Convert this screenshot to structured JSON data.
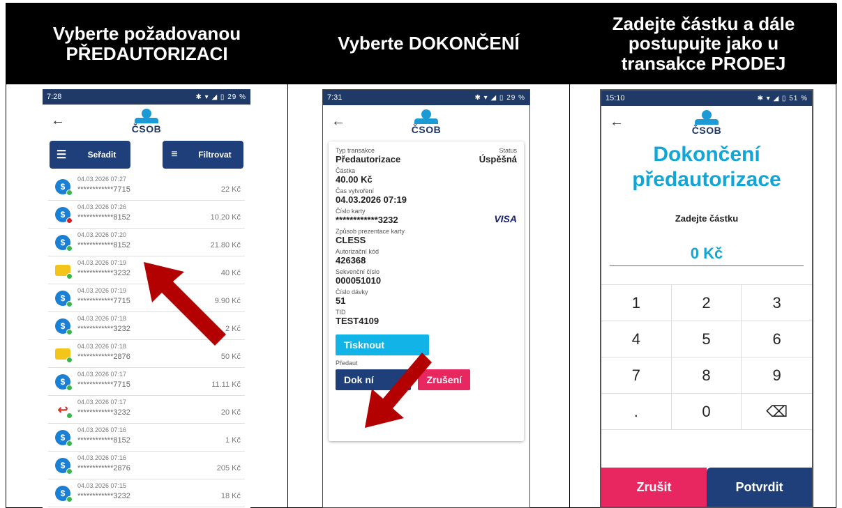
{
  "headers": [
    {
      "text": "Vyberte požadovanou PŘEDAUTORIZACI"
    },
    {
      "text": "Vyberte DOKONČENÍ"
    },
    {
      "text": "Zadejte částku a dále postupujte jako u transakce PRODEJ"
    }
  ],
  "phone1": {
    "time": "7:28",
    "status_icons": "✱ ▾ ◢ ▯ 29 %",
    "logo": "ČSOB",
    "sort_label": "Seřadit",
    "filter_label": "Filtrovat",
    "transactions": [
      {
        "date": "04.03.2026 07:27",
        "pan": "************7715",
        "amount": "22 Kč"
      },
      {
        "date": "04.03.2026 07:26",
        "pan": "************8152",
        "amount": "10.20 Kč"
      },
      {
        "date": "04.03.2026 07:20",
        "pan": "************8152",
        "amount": "21.80 Kč"
      },
      {
        "date": "04.03.2026 07:19",
        "pan": "************3232",
        "amount": "40 Kč"
      },
      {
        "date": "04.03.2026 07:19",
        "pan": "************7715",
        "amount": "9.90 Kč"
      },
      {
        "date": "04.03.2026 07:18",
        "pan": "************3232",
        "amount": "2 Kč"
      },
      {
        "date": "04.03.2026 07:18",
        "pan": "************2876",
        "amount": "50 Kč"
      },
      {
        "date": "04.03.2026 07:17",
        "pan": "************7715",
        "amount": "11.11 Kč"
      },
      {
        "date": "04.03.2026 07:17",
        "pan": "************3232",
        "amount": "20 Kč"
      },
      {
        "date": "04.03.2026 07:16",
        "pan": "************8152",
        "amount": "1 Kč"
      },
      {
        "date": "04.03.2026 07:16",
        "pan": "************2876",
        "amount": "205 Kč"
      },
      {
        "date": "04.03.2026 07:15",
        "pan": "************3232",
        "amount": "18 Kč"
      }
    ]
  },
  "phone2": {
    "time": "7:31",
    "status_icons": "✱ ▾ ◢ ▯ 29 %",
    "logo": "ČSOB",
    "type_label": "Typ transakce",
    "type_value": "Předautorizace",
    "status_label": "Status",
    "status_value": "Úspěšná",
    "amount_label": "Částka",
    "amount_value": "40.00 Kč",
    "created_label": "Čas vytvoření",
    "created_value": "04.03.2026 07:19",
    "card_label": "Číslo karty",
    "card_value": "************3232",
    "card_brand": "VISA",
    "present_label": "Způsob prezentace karty",
    "present_value": "CLESS",
    "auth_label": "Autorizační kód",
    "auth_value": "426368",
    "seq_label": "Sekvenční číslo",
    "seq_value": "000051010",
    "batch_label": "Číslo dávky",
    "batch_value": "51",
    "tid_label": "TID",
    "tid_value": "TEST4109",
    "print_label": "Tisknout",
    "preauth_label": "Předaut",
    "done_label": "Dok ní",
    "cancel_label": "Zrušení"
  },
  "phone3": {
    "time": "15:10",
    "status_icons": "✱ ▾ ◢ ▯ 51 %",
    "logo": "ČSOB",
    "title_line1": "Dokončení",
    "title_line2": "předautorizace",
    "prompt": "Zadejte částku",
    "amount": "0 Kč",
    "keys": [
      "1",
      "2",
      "3",
      "4",
      "5",
      "6",
      "7",
      "8",
      "9",
      ".",
      "0",
      "⌫"
    ],
    "cancel_label": "Zrušit",
    "confirm_label": "Potvrdit"
  },
  "colors": {
    "arrow": "#b30000",
    "accent": "#12a6d6",
    "navy": "#1e3f7a",
    "pink": "#e8265f"
  }
}
